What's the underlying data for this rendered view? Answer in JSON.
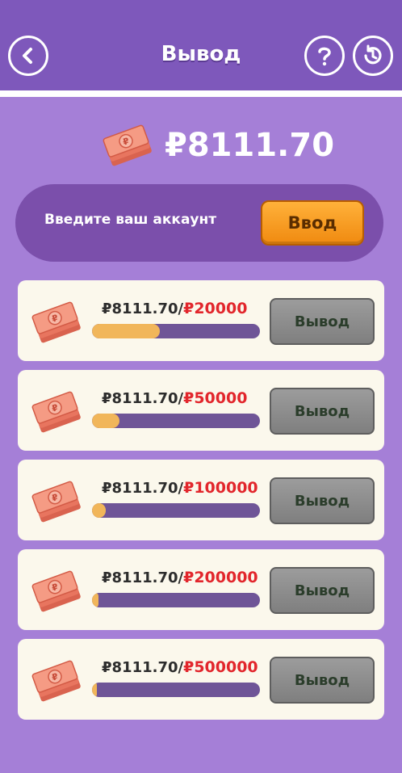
{
  "header": {
    "title": "Вывод"
  },
  "balance": {
    "amount": "₽8111.70"
  },
  "account": {
    "label": "Введите ваш аккаунт",
    "enter_label": "Ввод"
  },
  "cards": [
    {
      "current": "₽8111.70/",
      "target": "₽20000",
      "progress": 0.4056,
      "button": "Вывод"
    },
    {
      "current": "₽8111.70/",
      "target": "₽50000",
      "progress": 0.1622,
      "button": "Вывод"
    },
    {
      "current": "₽8111.70/",
      "target": "₽100000",
      "progress": 0.0811,
      "button": "Вывод"
    },
    {
      "current": "₽8111.70/",
      "target": "₽200000",
      "progress": 0.0406,
      "button": "Вывод"
    },
    {
      "current": "₽8111.70/",
      "target": "₽500000",
      "progress": 0.0162,
      "button": "Вывод"
    }
  ],
  "colors": {
    "accent": "#7e58bb",
    "background": "#a57fd7",
    "progress_fill": "#f1b65a",
    "target_text": "#e2262c"
  }
}
